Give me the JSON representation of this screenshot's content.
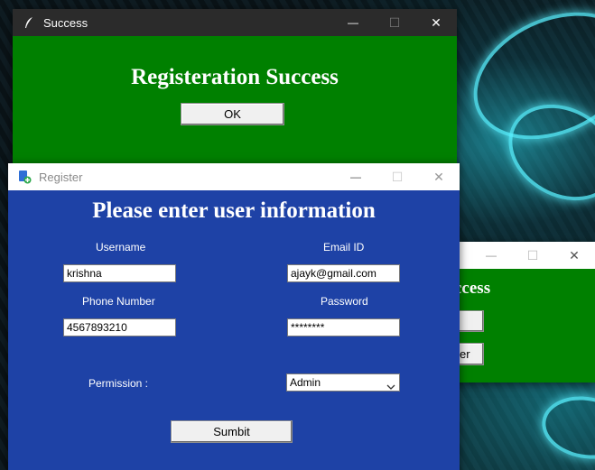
{
  "success_window": {
    "title": "Success",
    "heading": "Registeration Success",
    "ok_label": "OK",
    "bg_color": "#008000"
  },
  "register_window": {
    "title": "Register",
    "heading": "Please enter user information",
    "bg_color": "#1e42a6",
    "username_label": "Username",
    "username_value": "krishna",
    "email_label": "Email ID",
    "email_value": "ajayk@gmail.com",
    "phone_label": "Phone Number",
    "phone_value": "4567893210",
    "password_label": "Password",
    "password_value": "********",
    "permission_label": "Permission :",
    "permission_value": "Admin",
    "submit_label": "Sumbit"
  },
  "background_window": {
    "heading_fragment": "ccess",
    "button2_fragment": "er"
  },
  "controls": {
    "minimize": "—",
    "maximize": "☐",
    "close": "✕"
  }
}
